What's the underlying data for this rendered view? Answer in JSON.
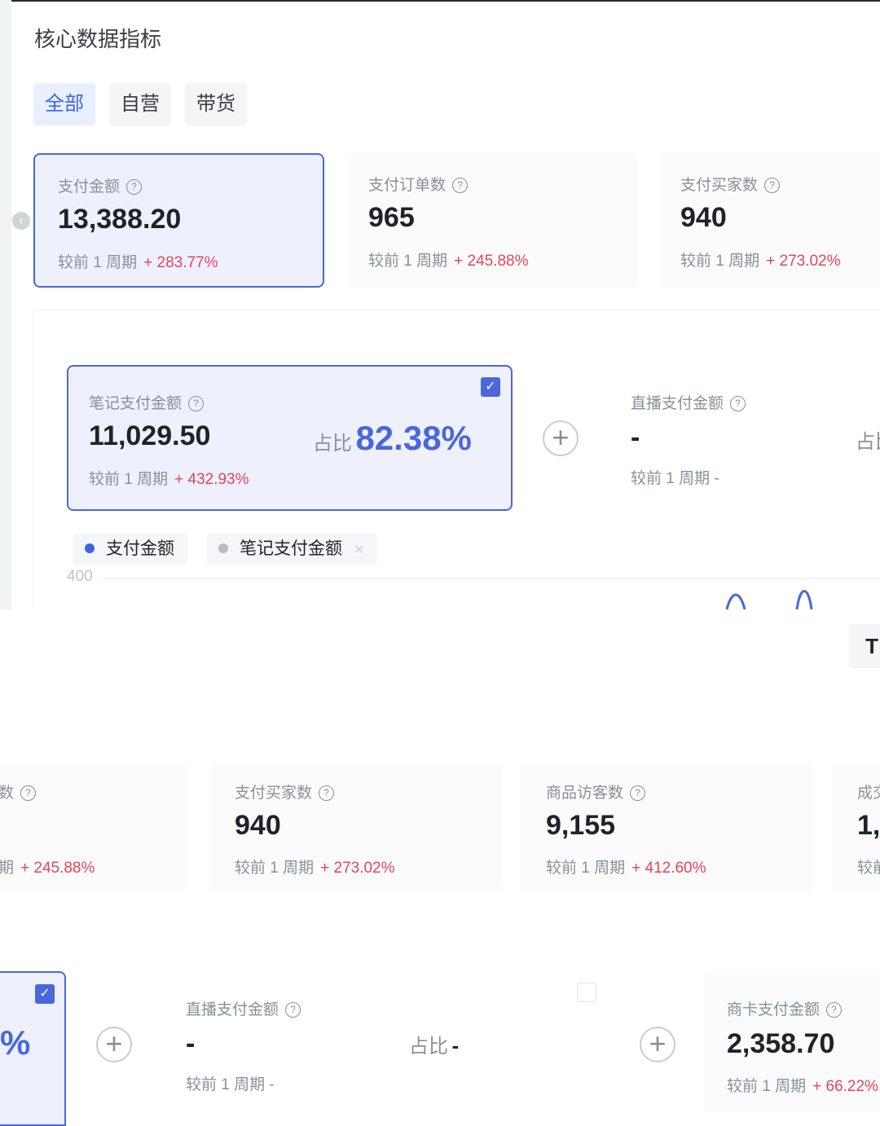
{
  "section": {
    "title": "核心数据指标"
  },
  "tabs": [
    {
      "label": "全部",
      "active": true
    },
    {
      "label": "自营",
      "active": false
    },
    {
      "label": "带货",
      "active": false
    }
  ],
  "compare_label": "较前 1 周期",
  "top_metrics": [
    {
      "label": "支付金额",
      "value": "13,388.20",
      "change": "+ 283.77%",
      "selected": true
    },
    {
      "label": "支付订单数",
      "value": "965",
      "change": "+ 245.88%",
      "selected": false
    },
    {
      "label": "支付买家数",
      "value": "940",
      "change": "+ 273.02%",
      "selected": false
    }
  ],
  "sub_metrics": [
    {
      "label": "笔记支付金额",
      "value": "11,029.50",
      "change": "+ 432.93%",
      "share_label": "占比",
      "share_value": "82.38%",
      "checked": true
    },
    {
      "label": "直播支付金额",
      "value": "-",
      "change": "-",
      "share_label": "占比",
      "share_value": ""
    }
  ],
  "chart": {
    "legend": [
      {
        "label": "支付金额",
        "color": "#3d63e6"
      },
      {
        "label": "笔记支付金额",
        "color": "#b7bbc2"
      }
    ],
    "y_tick_top": "400",
    "line_color": "#4a68d9"
  },
  "side_stub_text": "T",
  "bottom_metrics": [
    {
      "label_partial": "数",
      "change_partial": "期",
      "change": "+ 245.88%"
    },
    {
      "label": "支付买家数",
      "value": "940",
      "change": "+ 273.02%"
    },
    {
      "label": "商品访客数",
      "value": "9,155",
      "change": "+ 412.60%"
    },
    {
      "label": "成交",
      "value": "1,",
      "compare": "较前"
    }
  ],
  "bottom_sub": {
    "left_share_partial": "%",
    "live": {
      "label": "直播支付金额",
      "value": "-",
      "change": "-",
      "share_label": "占比",
      "share_value": "-"
    },
    "card": {
      "label": "商卡支付金额",
      "value": "2,358.70",
      "change": "+ 66.22%"
    }
  },
  "colors": {
    "accent": "#4a68d9",
    "up": "#e8445a",
    "muted": "#8a8f99"
  }
}
